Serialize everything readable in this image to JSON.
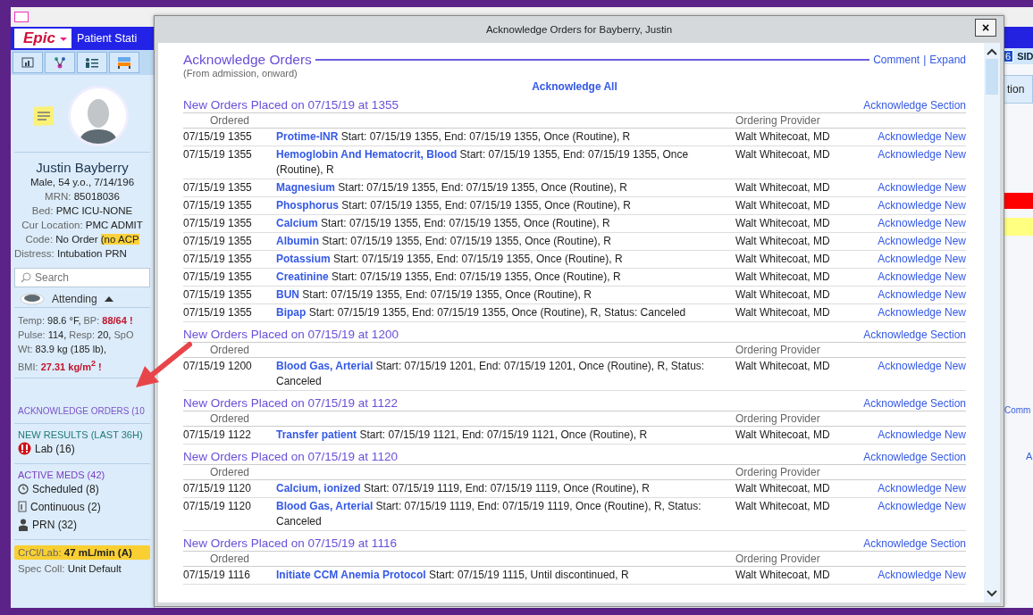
{
  "sidebar": {
    "logo": "Epic",
    "tab": "Patient Stati",
    "patient": {
      "name": "Justin Bayberry",
      "demographics": "Male, 54 y.o., 7/14/196",
      "fields": [
        {
          "label": "MRN:",
          "value": "85018036"
        },
        {
          "label": "Bed:",
          "value": "PMC ICU-NONE"
        },
        {
          "label": "Cur Location:",
          "value": "PMC ADMIT"
        },
        {
          "label": "Code:",
          "value": "No Order",
          "flag": "(no ACP"
        }
      ],
      "distress": {
        "label": "Distress:",
        "value": "Intubation PRN"
      }
    },
    "search": {
      "placeholder": "Search"
    },
    "attending": "Attending",
    "vitals": [
      [
        {
          "label": "Temp:",
          "value": "98.6 °F,",
          "abnormal": false
        },
        {
          "label": "BP:",
          "value": "88/64",
          "abnormal": true,
          "flag": "!"
        }
      ],
      [
        {
          "label": "Pulse:",
          "value": "114,",
          "abnormal": false
        },
        {
          "label": "Resp:",
          "value": "20,",
          "abnormal": false
        },
        {
          "label": "SpO",
          "abnormal": false
        }
      ],
      [
        {
          "label": "Wt:",
          "value": "83.9 kg (185 lb),",
          "abnormal": false
        }
      ],
      [
        {
          "label": "BMI:",
          "value": "27.31 kg/m$^{2}$",
          "abnormal": true,
          "flag": "!"
        }
      ]
    ],
    "acknowledge_orders": "ACKNOWLEDGE ORDERS (10",
    "new_results": {
      "heading": "NEW RESULTS (LAST 36H)",
      "items": [
        {
          "label": "Lab (16)",
          "kind": "lab"
        }
      ]
    },
    "active_meds": {
      "heading": "ACTIVE MEDS (42)",
      "items": [
        {
          "label": "Scheduled (8)",
          "kind": "scheduled"
        },
        {
          "label": "Continuous (2)",
          "kind": "continuous"
        },
        {
          "label": "PRN (32)",
          "kind": "prn"
        }
      ]
    },
    "crcl": {
      "label": "CrCl/Lab:",
      "value": "47 mL/min (A)"
    },
    "spec_coll": {
      "label": "Spec Coll:",
      "value": "Unit Default"
    }
  },
  "right_edge": {
    "badge": "6",
    "label": "SID",
    "tab": "tion",
    "link": "Comm",
    "letter": "A"
  },
  "dialog": {
    "title": "Acknowledge Orders for Bayberry, Justin",
    "close": "×",
    "heading": "Acknowledge Orders",
    "links": [
      "Comment",
      "Expand"
    ],
    "separator": "|",
    "subtitle": "(From admission, onward)",
    "acknowledge_all": "Acknowledge All",
    "sections": [
      {
        "title": "New Orders Placed on 07/15/19 at 1355",
        "action": "Acknowledge Section",
        "columns": [
          "Ordered",
          "Ordering Provider"
        ],
        "rows": [
          {
            "ordered": "07/15/19 1355",
            "order": "Protime-INR",
            "details": "Start: 07/15/19 1355, End: 07/15/19 1355, Once (Routine), R",
            "provider": "Walt Whitecoat, MD",
            "action": "Acknowledge New"
          },
          {
            "ordered": "07/15/19 1355",
            "order": "Hemoglobin And Hematocrit, Blood",
            "details": "Start: 07/15/19 1355, End: 07/15/19 1355, Once (Routine), R",
            "provider": "Walt Whitecoat, MD",
            "action": "Acknowledge New"
          },
          {
            "ordered": "07/15/19 1355",
            "order": "Magnesium",
            "details": "Start: 07/15/19 1355, End: 07/15/19 1355, Once (Routine), R",
            "provider": "Walt Whitecoat, MD",
            "action": "Acknowledge New"
          },
          {
            "ordered": "07/15/19 1355",
            "order": "Phosphorus",
            "details": "Start: 07/15/19 1355, End: 07/15/19 1355, Once (Routine), R",
            "provider": "Walt Whitecoat, MD",
            "action": "Acknowledge New"
          },
          {
            "ordered": "07/15/19 1355",
            "order": "Calcium",
            "details": "Start: 07/15/19 1355, End: 07/15/19 1355, Once (Routine), R",
            "provider": "Walt Whitecoat, MD",
            "action": "Acknowledge New"
          },
          {
            "ordered": "07/15/19 1355",
            "order": "Albumin",
            "details": "Start: 07/15/19 1355, End: 07/15/19 1355, Once (Routine), R",
            "provider": "Walt Whitecoat, MD",
            "action": "Acknowledge New"
          },
          {
            "ordered": "07/15/19 1355",
            "order": "Potassium",
            "details": "Start: 07/15/19 1355, End: 07/15/19 1355, Once (Routine), R",
            "provider": "Walt Whitecoat, MD",
            "action": "Acknowledge New"
          },
          {
            "ordered": "07/15/19 1355",
            "order": "Creatinine",
            "details": "Start: 07/15/19 1355, End: 07/15/19 1355, Once (Routine), R",
            "provider": "Walt Whitecoat, MD",
            "action": "Acknowledge New"
          },
          {
            "ordered": "07/15/19 1355",
            "order": "BUN",
            "details": "Start: 07/15/19 1355, End: 07/15/19 1355, Once (Routine), R",
            "provider": "Walt Whitecoat, MD",
            "action": "Acknowledge New"
          },
          {
            "ordered": "07/15/19 1355",
            "order": "Bipap",
            "details": "Start: 07/15/19 1355, End: 07/15/19 1355, Once (Routine), R, Status: Canceled",
            "provider": "Walt Whitecoat, MD",
            "action": "Acknowledge New"
          }
        ]
      },
      {
        "title": "New Orders Placed on 07/15/19 at 1200",
        "action": "Acknowledge Section",
        "columns": [
          "Ordered",
          "Ordering Provider"
        ],
        "rows": [
          {
            "ordered": "07/15/19 1200",
            "order": "Blood Gas, Arterial",
            "details": "Start: 07/15/19 1201, End: 07/15/19 1201, Once (Routine), R, Status: Canceled",
            "provider": "Walt Whitecoat, MD",
            "action": "Acknowledge New"
          }
        ]
      },
      {
        "title": "New Orders Placed on 07/15/19 at 1122",
        "action": "Acknowledge Section",
        "columns": [
          "Ordered",
          "Ordering Provider"
        ],
        "rows": [
          {
            "ordered": "07/15/19 1122",
            "order": "Transfer patient",
            "details": "Start: 07/15/19 1121, End: 07/15/19 1121, Once (Routine), R",
            "provider": "Walt Whitecoat, MD",
            "action": "Acknowledge New"
          }
        ]
      },
      {
        "title": "New Orders Placed on 07/15/19 at 1120",
        "action": "Acknowledge Section",
        "columns": [
          "Ordered",
          "Ordering Provider"
        ],
        "rows": [
          {
            "ordered": "07/15/19 1120",
            "order": "Calcium, ionized",
            "details": "Start: 07/15/19 1119, End: 07/15/19 1119, Once (Routine), R",
            "provider": "Walt Whitecoat, MD",
            "action": "Acknowledge New"
          },
          {
            "ordered": "07/15/19 1120",
            "order": "Blood Gas, Arterial",
            "details": "Start: 07/15/19 1119, End: 07/15/19 1119, Once (Routine), R, Status: Canceled",
            "provider": "Walt Whitecoat, MD",
            "action": "Acknowledge New"
          }
        ]
      },
      {
        "title": "New Orders Placed on 07/15/19 at 1116",
        "action": "Acknowledge Section",
        "columns": [
          "Ordered",
          "Ordering Provider"
        ],
        "rows": [
          {
            "ordered": "07/15/19 1116",
            "order": "Initiate CCM Anemia Protocol",
            "details": "Start: 07/15/19 1115, Until discontinued, R",
            "provider": "Walt Whitecoat, MD",
            "action": "Acknowledge New"
          }
        ]
      }
    ]
  }
}
